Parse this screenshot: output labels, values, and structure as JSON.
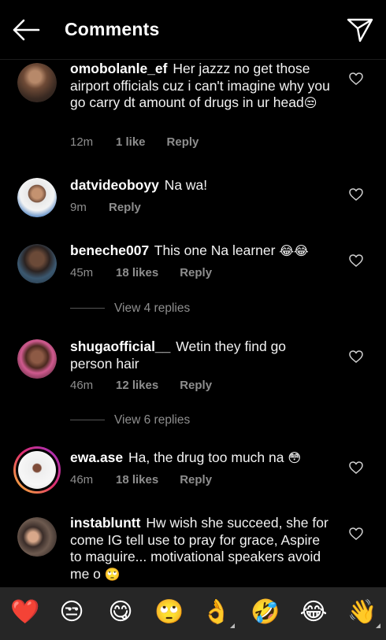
{
  "header": {
    "title": "Comments"
  },
  "comments": [
    {
      "username": "omobolanle_ef",
      "text": "Her jazzz no get those airport officials cuz i can't imagine why you go carry dt amount of drugs in ur head",
      "emoji": "😒",
      "time": "12m",
      "likes": "1 like",
      "reply": "Reply"
    },
    {
      "username": "datvideoboyy",
      "text": "Na wa!",
      "emoji": "",
      "time": "9m",
      "likes": "",
      "reply": "Reply"
    },
    {
      "username": "beneche007",
      "text": "This one Na learner",
      "emoji": "😂😂",
      "time": "45m",
      "likes": "18 likes",
      "reply": "Reply",
      "view_replies": "View 4 replies"
    },
    {
      "username": "shugaofficial__",
      "text": "Wetin they find go person hair",
      "emoji": "",
      "time": "46m",
      "likes": "12 likes",
      "reply": "Reply",
      "view_replies": "View 6 replies"
    },
    {
      "username": "ewa.ase",
      "text": "Ha, the drug too much na",
      "emoji": "😳",
      "time": "46m",
      "likes": "18 likes",
      "reply": "Reply"
    },
    {
      "username": "instabluntt",
      "text": "Hw wish she succeed, she for come IG tell use to pray for grace, Aspire to maguire... motivational speakers avoid me o",
      "emoji": "🙄",
      "time": "",
      "likes": "",
      "reply": ""
    }
  ],
  "emoji_bar": [
    "❤️",
    "😒",
    "😋",
    "🙄",
    "👌",
    "🤣",
    "😂",
    "👋"
  ],
  "colors": {
    "background": "#000000",
    "secondary_text": "#8e8e8e",
    "emoji_bar_bg": "#262626"
  }
}
